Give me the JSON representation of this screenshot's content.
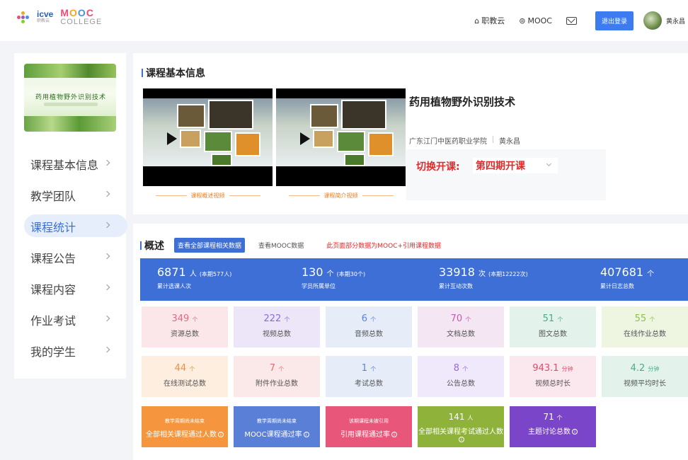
{
  "header": {
    "logo_icve": "icve",
    "logo_icve_sub": "职教云",
    "logo_mooc": "MOOC",
    "logo_college": "COLLEGE",
    "nav": [
      {
        "label": "职教云",
        "icon": "home-icon"
      },
      {
        "label": "MOOC",
        "icon": "mooc-icon"
      }
    ],
    "mail_icon": "mail-icon",
    "logout_label": "退出登录",
    "username": "黄永昌"
  },
  "sidebar": {
    "cover_title": "药用植物野外识别技术",
    "items": [
      {
        "label": "课程基本信息"
      },
      {
        "label": "教学团队"
      },
      {
        "label": "课程统计",
        "active": true
      },
      {
        "label": "课程公告"
      },
      {
        "label": "课程内容"
      },
      {
        "label": "作业考试"
      },
      {
        "label": "我的学生"
      }
    ]
  },
  "basic_info": {
    "section_title": "课程基本信息",
    "video1_caption": "课程概述视频",
    "video2_caption": "课程简介视频",
    "course_title": "药用植物野外识别技术",
    "school": "广东江门中医药职业学院",
    "teacher": "黄永昌",
    "switch_label": "切换开课:",
    "switch_value": "第四期开课"
  },
  "overview": {
    "section_title": "概述",
    "tab_all": "查看全部课程相关数据",
    "tab_mooc": "查看MOOC数据",
    "note": "此页面部分数据为MOOC+引用课程数据",
    "band": [
      {
        "value": "6871",
        "unit": "人",
        "extra": "(本期577人)",
        "label": "累计选课人次"
      },
      {
        "value": "130",
        "unit": "个",
        "extra": "(本期30个)",
        "label": "学员所属单位"
      },
      {
        "value": "33918",
        "unit": "次",
        "extra": "(本期12222次)",
        "label": "累计互动次数"
      },
      {
        "value": "407681",
        "unit": "个",
        "extra": "",
        "label": "累计日志总数"
      }
    ],
    "tiles_row1": [
      {
        "value": "349",
        "unit": "个",
        "label": "资源总数",
        "bg": "#fbe7ea",
        "color": "#e06a80"
      },
      {
        "value": "222",
        "unit": "个",
        "label": "视频总数",
        "bg": "#ece6f8",
        "color": "#8a6bd6"
      },
      {
        "value": "6",
        "unit": "个",
        "label": "音频总数",
        "bg": "#e6edf9",
        "color": "#5a83d6"
      },
      {
        "value": "70",
        "unit": "个",
        "label": "文档总数",
        "bg": "#f5e6f3",
        "color": "#c05cb0"
      },
      {
        "value": "51",
        "unit": "个",
        "label": "图文总数",
        "bg": "#e3f3ec",
        "color": "#4aab84"
      },
      {
        "value": "55",
        "unit": "个",
        "label": "在线作业总数",
        "bg": "#eef6e2",
        "color": "#8fbf4a"
      }
    ],
    "tiles_row2": [
      {
        "value": "44",
        "unit": "个",
        "label": "在线测试总数",
        "bg": "#fdeee0",
        "color": "#f09040"
      },
      {
        "value": "7",
        "unit": "个",
        "label": "附件作业总数",
        "bg": "#fbe8e8",
        "color": "#e07070"
      },
      {
        "value": "1",
        "unit": "个",
        "label": "考试总数",
        "bg": "#e6edf9",
        "color": "#5a83d6"
      },
      {
        "value": "8",
        "unit": "个",
        "label": "公告总数",
        "bg": "#f0e8fb",
        "color": "#9a6bd6"
      },
      {
        "value": "943.1",
        "unit": "分钟",
        "label": "视频总时长",
        "bg": "#fbe8ee",
        "color": "#e04a6a"
      },
      {
        "value": "4.2",
        "unit": "分钟",
        "label": "视频平均时长",
        "bg": "#e3f3ec",
        "color": "#4aab84"
      }
    ],
    "solid_row": [
      {
        "top": "教学周期尚未结束",
        "bottom": "全部相关课程通过人数",
        "bg": "#f5963e"
      },
      {
        "top": "教学周期尚未结束",
        "bottom": "MOOC课程通过率",
        "bg": "#5a7fd6"
      },
      {
        "top": "该期课程未被引用",
        "bottom": "引用课程通过率",
        "bg": "#e8577a"
      },
      {
        "big": "141",
        "unit": "人",
        "bottom": "全部相关课程考试通过人数",
        "bg": "#8fb33a"
      },
      {
        "big": "71",
        "unit": "个",
        "bottom": "主题讨论总数",
        "bg": "#7a45c8"
      }
    ]
  }
}
